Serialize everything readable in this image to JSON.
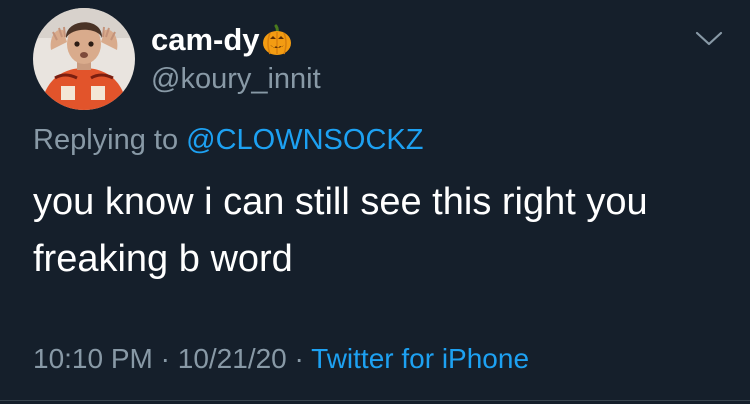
{
  "author": {
    "display_name": "cam-dy",
    "emoji": "pumpkin-emoji",
    "handle": "@koury_innit"
  },
  "reply": {
    "prefix": "Replying to ",
    "mention": "@CLOWNSOCKZ"
  },
  "tweet": {
    "text": "you know i can still see this right you freaking b word"
  },
  "meta": {
    "time": "10:10 PM",
    "separator1": " · ",
    "date": "10/21/20",
    "separator2": " · ",
    "source": "Twitter for iPhone"
  },
  "icons": {
    "menu": "chevron-down-icon"
  },
  "colors": {
    "background": "#151f2b",
    "text": "#ffffff",
    "secondary": "#8899a6",
    "link": "#1da1f2"
  }
}
